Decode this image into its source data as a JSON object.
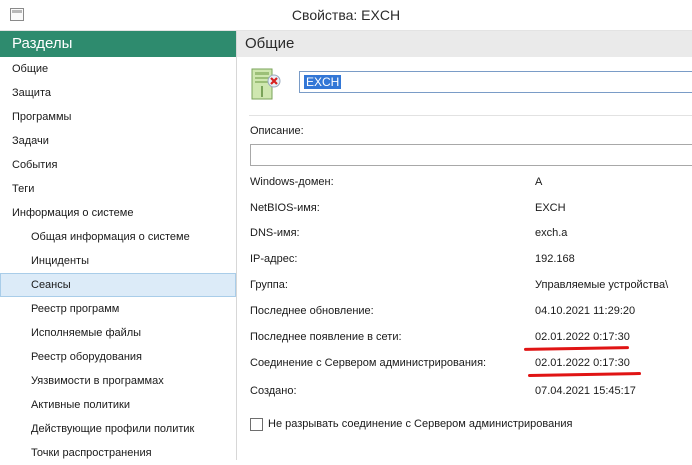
{
  "window": {
    "title": "Свойства: EXCH"
  },
  "sidebar": {
    "header": "Разделы",
    "items": [
      {
        "label": "Общие"
      },
      {
        "label": "Защита"
      },
      {
        "label": "Программы"
      },
      {
        "label": "Задачи"
      },
      {
        "label": "События"
      },
      {
        "label": "Теги"
      },
      {
        "label": "Информация о системе"
      },
      {
        "label": "Общая информация о системе"
      },
      {
        "label": "Инциденты"
      },
      {
        "label": "Сеансы"
      },
      {
        "label": "Реестр программ"
      },
      {
        "label": "Исполняемые файлы"
      },
      {
        "label": "Реестр оборудования"
      },
      {
        "label": "Уязвимости в программах"
      },
      {
        "label": "Активные политики"
      },
      {
        "label": "Действующие профили политик"
      },
      {
        "label": "Точки распространения"
      }
    ]
  },
  "main": {
    "header": "Общие",
    "device_name": "EXCH",
    "description_label": "Описание:",
    "fields": [
      {
        "label": "Windows-домен:",
        "value": "A"
      },
      {
        "label": "NetBIOS-имя:",
        "value": "EXCH"
      },
      {
        "label": "DNS-имя:",
        "value": "exch.a"
      },
      {
        "label": "IP-адрес:",
        "value": "192.168"
      },
      {
        "label": "Группа:",
        "value": "Управляемые устройства\\"
      },
      {
        "label": "Последнее обновление:",
        "value": "04.10.2021 11:29:20"
      },
      {
        "label": "Последнее появление в сети:",
        "value": "02.01.2022 0:17:30"
      },
      {
        "label": "Соединение с Сервером администрирования:",
        "value": "02.01.2022 0:17:30"
      },
      {
        "label": "Создано:",
        "value": "07.04.2021 15:45:17"
      }
    ],
    "checkbox_label": "Не разрывать соединение с Сервером администрирования",
    "annotation_color": "#e01414"
  }
}
